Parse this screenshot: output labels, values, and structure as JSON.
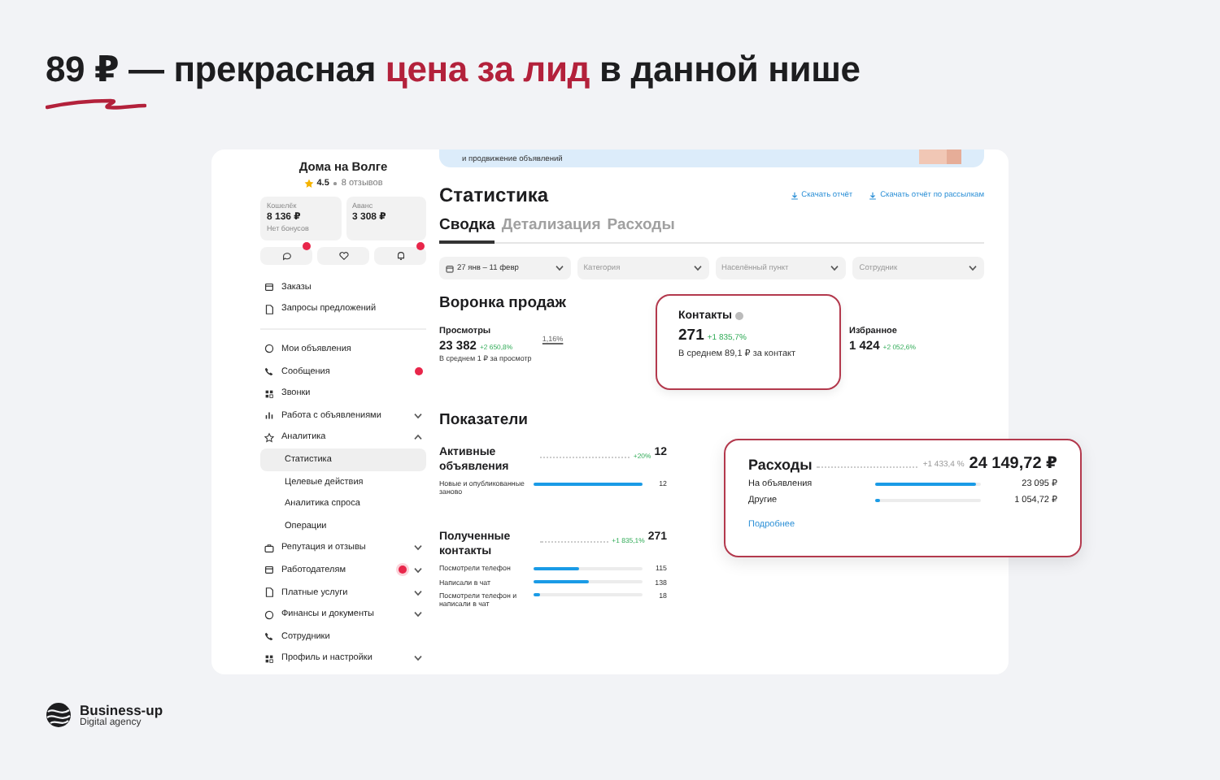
{
  "headline": {
    "parts": [
      {
        "text": "89 ₽ — прекрасная",
        "accent": false
      },
      {
        "text": "цена за лид",
        "accent": true
      },
      {
        "text": "в данной нише",
        "accent": false
      }
    ]
  },
  "sidebar": {
    "shop_name": "Дома на Волге",
    "rating": "4.5",
    "reviews": "8 отзывов",
    "wallets": [
      {
        "label": "Кошелёк",
        "value": "8 136 ₽",
        "note": "Нет бонусов"
      },
      {
        "label": "Аванс",
        "value": "3 308 ₽"
      }
    ],
    "quick_buttons": [
      {
        "badge": true
      },
      {
        "badge": false
      },
      {
        "badge": true
      }
    ],
    "groups": [
      [
        {
          "label": "Заказы",
          "kind": "link"
        },
        {
          "label": "Запросы предложений",
          "kind": "link"
        }
      ],
      [
        {
          "label": "Мои объявления",
          "kind": "link"
        },
        {
          "label": "Сообщения",
          "kind": "link",
          "badge": true
        },
        {
          "label": "Звонки",
          "kind": "link"
        },
        {
          "label": "Работа с объявлениями",
          "kind": "group",
          "expanded": false
        },
        {
          "label": "Аналитика",
          "kind": "group",
          "expanded": true,
          "children": [
            {
              "label": "Статистика",
              "selected": true
            },
            {
              "label": "Целевые действия",
              "selected": false
            },
            {
              "label": "Аналитика спроса",
              "selected": false
            },
            {
              "label": "Операции",
              "selected": false
            }
          ]
        },
        {
          "label": "Репутация и отзывы",
          "kind": "group",
          "expanded": false
        },
        {
          "label": "Работодателям",
          "kind": "group",
          "expanded": false,
          "badge": true
        },
        {
          "label": "Платные услуги",
          "kind": "group",
          "expanded": false
        },
        {
          "label": "Финансы и документы",
          "kind": "group",
          "expanded": false
        },
        {
          "label": "Сотрудники",
          "kind": "link"
        },
        {
          "label": "Профиль и настройки",
          "kind": "group",
          "expanded": false
        }
      ]
    ]
  },
  "main": {
    "banner": {
      "text": "и продвижение объявлений"
    },
    "title": "Статистика",
    "actions": [
      "Скачать отчёт",
      "Скачать отчёт по рассылкам"
    ],
    "tabs": [
      {
        "label": "Сводка",
        "selected": true
      },
      {
        "label": "Детализация",
        "selected": false
      },
      {
        "label": "Расходы",
        "selected": false
      }
    ],
    "filters": [
      {
        "kind": "date",
        "value": "27 янв – 11 февр"
      },
      {
        "kind": "select",
        "placeholder": "Категория"
      },
      {
        "kind": "select",
        "placeholder": "Населённый пункт"
      },
      {
        "kind": "select",
        "placeholder": "Сотрудник"
      }
    ],
    "funnel": {
      "title": "Воронка продаж",
      "conversion": "1,16%",
      "steps": [
        {
          "label": "Просмотры",
          "value": "23 382",
          "change": "+2 650,8%",
          "note": "В среднем 1 ₽ за просмотр",
          "highlighted": false
        },
        {
          "label": "Контакты",
          "value": "271",
          "change": "+1 835,7%",
          "note": "В среднем 89,1 ₽ за контакт",
          "highlighted": true
        },
        {
          "label": "Избранное",
          "value": "1 424",
          "change": "+2 052,6%",
          "highlighted": false
        }
      ]
    },
    "indicators": {
      "title": "Показатели",
      "metrics": [
        {
          "title": "Активные объявления",
          "change": "+20%",
          "value": "12",
          "bars": [
            {
              "label": "Новые и опубликованные заново",
              "level": 1.0,
              "value": "12"
            }
          ]
        },
        {
          "title": "Полученные контакты",
          "change": "+1 835,1%",
          "value": "271",
          "bars": [
            {
              "label": "Посмотрели телефон",
              "level": 0.42,
              "value": "115"
            },
            {
              "label": "Написали в чат",
              "level": 0.51,
              "value": "138"
            },
            {
              "label": "Посмотрели телефон и написали в чат",
              "level": 0.06,
              "value": "18"
            }
          ]
        }
      ]
    }
  },
  "expenses": {
    "title": "Расходы",
    "change": "+1 433,4 %",
    "total": "24 149,72 ₽",
    "rows": [
      {
        "label": "На объявления",
        "level": 0.96,
        "value": "23 095 ₽"
      },
      {
        "label": "Другие",
        "level": 0.04,
        "value": "1 054,72 ₽"
      }
    ],
    "link": "Подробнее"
  },
  "brand": {
    "name": "Business-up",
    "tagline": "Digital agency"
  }
}
